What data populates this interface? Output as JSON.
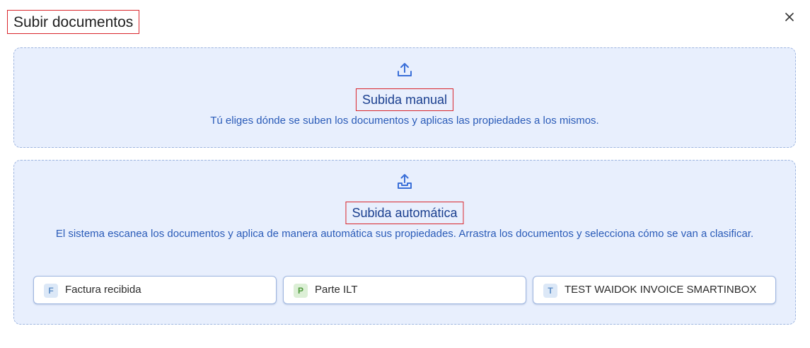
{
  "dialog": {
    "title": "Subir documentos",
    "close_icon": "close-icon"
  },
  "manual": {
    "icon": "upload-icon",
    "title": "Subida manual",
    "description": "Tú eliges dónde se suben los documentos y aplicas las propiedades a los mismos."
  },
  "auto": {
    "icon": "upload-tray-icon",
    "title": "Subida automática",
    "description": "El sistema escanea los documentos y aplica de manera automática sus propiedades. Arrastra los documentos y selecciona cómo se van a clasificar."
  },
  "document_types": [
    {
      "badge": "F",
      "label": "Factura recibida",
      "badge_color": "#5f8fc7"
    },
    {
      "badge": "P",
      "label": "Parte ILT",
      "badge_color": "#4f9a3c"
    },
    {
      "badge": "T",
      "label": "TEST WAIDOK INVOICE SMARTINBOX",
      "badge_color": "#5f8fc7"
    }
  ],
  "colors": {
    "zone_background": "#e8effd",
    "zone_border": "#9fb6e0",
    "title_blue": "#1a3f8f",
    "text_blue": "#2a5bb8",
    "highlight_red": "#d9262c"
  }
}
